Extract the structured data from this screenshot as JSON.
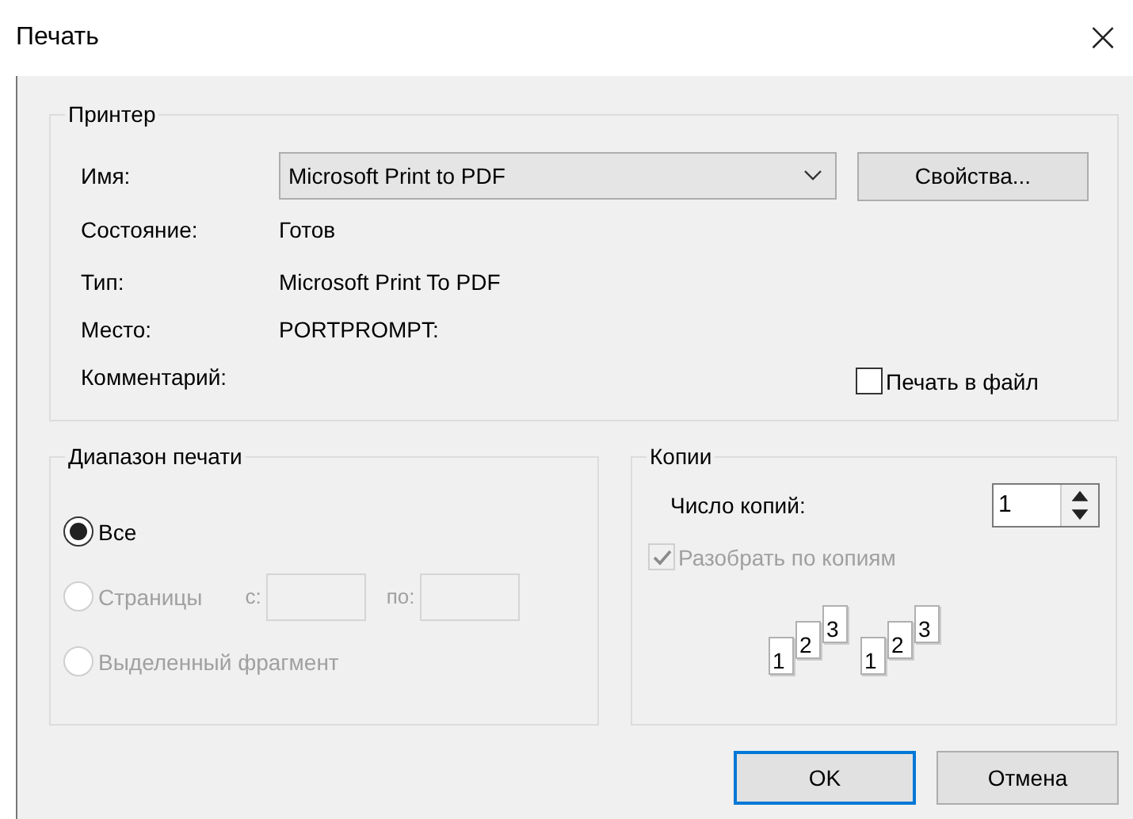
{
  "window": {
    "title": "Печать",
    "close": "×"
  },
  "printer": {
    "title": "Принтер",
    "name_label": "Имя:",
    "name_value": "Microsoft Print to PDF",
    "properties_button": "Свойства...",
    "info": [
      {
        "label": "Состояние:",
        "value": "Готов"
      },
      {
        "label": "Тип:",
        "value": "Microsoft Print To PDF"
      },
      {
        "label": "Место:",
        "value": "PORTPROMPT:"
      },
      {
        "label": "Комментарий:"
      }
    ],
    "print_to_file": {
      "label": "Печать в файл",
      "checked": false
    }
  },
  "range": {
    "title": "Диапазон печати",
    "options": [
      {
        "kind": "plain",
        "label": "Все",
        "selected": true,
        "disabled": false
      },
      {
        "kind": "pages",
        "label": "Страницы",
        "selected": false,
        "disabled": true,
        "from_label": "с:",
        "to_label": "по:"
      },
      {
        "kind": "plain",
        "label": "Выделенный фрагмент",
        "selected": false,
        "disabled": true
      }
    ]
  },
  "copies": {
    "title": "Копии",
    "count_label": "Число копий:",
    "count_value": "1",
    "collate": {
      "label": "Разобрать по копиям",
      "checked": true,
      "disabled": true
    },
    "collate_sets": [
      [
        "1",
        "2",
        "3"
      ],
      [
        "1",
        "2",
        "3"
      ]
    ]
  },
  "buttons": [
    {
      "label": "OK",
      "default": true
    },
    {
      "label": "Отмена",
      "default": false
    }
  ]
}
